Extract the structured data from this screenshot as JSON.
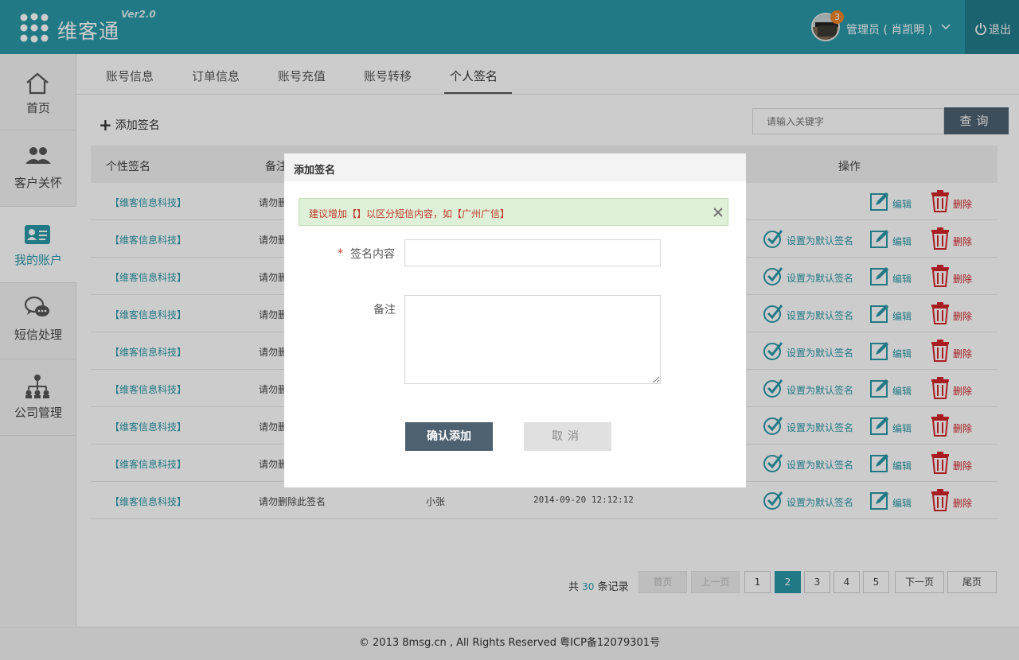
{
  "app": {
    "name": "维客通",
    "version": "Ver2.0"
  },
  "user": {
    "name": "管理员 ( 肖凯明 )",
    "notification_count": "3",
    "logout_label": "退出"
  },
  "sidebar": {
    "items": [
      {
        "label": "首页",
        "icon": "home-icon"
      },
      {
        "label": "客户关怀",
        "icon": "users-icon"
      },
      {
        "label": "我的账户",
        "icon": "id-card-icon",
        "active": true
      },
      {
        "label": "短信处理",
        "icon": "chat-icon"
      },
      {
        "label": "公司管理",
        "icon": "org-chart-icon"
      }
    ]
  },
  "tabs": [
    {
      "label": "账号信息"
    },
    {
      "label": "订单信息"
    },
    {
      "label": "账号充值"
    },
    {
      "label": "账号转移"
    },
    {
      "label": "个人签名",
      "active": true
    }
  ],
  "toolbar": {
    "add_label": "添加签名",
    "search_placeholder": "请输入关键字",
    "search_label": "查询"
  },
  "table": {
    "headers": {
      "signature": "个性签名",
      "remark": "备注",
      "actions": "操作"
    },
    "rows": [
      {
        "signature": "【维客信息科技】",
        "remark": "请勿删",
        "creator": "",
        "time": "",
        "default": true
      },
      {
        "signature": "【维客信息科技】",
        "remark": "请勿删",
        "creator": "",
        "time": "",
        "default": false
      },
      {
        "signature": "【维客信息科技】",
        "remark": "请勿删",
        "creator": "",
        "time": "",
        "default": false
      },
      {
        "signature": "【维客信息科技】",
        "remark": "请勿删",
        "creator": "",
        "time": "",
        "default": false
      },
      {
        "signature": "【维客信息科技】",
        "remark": "请勿删",
        "creator": "",
        "time": "",
        "default": false
      },
      {
        "signature": "【维客信息科技】",
        "remark": "请勿删",
        "creator": "",
        "time": "",
        "default": false
      },
      {
        "signature": "【维客信息科技】",
        "remark": "请勿删",
        "creator": "",
        "time": "",
        "default": false
      },
      {
        "signature": "【维客信息科技】",
        "remark": "请勿删",
        "creator": "",
        "time": "",
        "default": false
      },
      {
        "signature": "【维客信息科技】",
        "remark": "请勿删除此签名",
        "creator": "小张",
        "time": "2014-09-20 12:12:12",
        "default": false
      }
    ],
    "actions": {
      "set_default": "设置为默认签名",
      "edit": "编辑",
      "delete": "删除"
    }
  },
  "pagination": {
    "total_prefix": "共",
    "total": "30",
    "total_suffix": "条记录",
    "first": "首页",
    "prev": "上一页",
    "pages": [
      "1",
      "2",
      "3",
      "4",
      "5"
    ],
    "current": "2",
    "next": "下一页",
    "last": "尾页"
  },
  "footer": {
    "text": "© 2013 8msg.cn , All Rights Reserved 粤ICP备12079301号"
  },
  "modal": {
    "title": "添加签名",
    "hint": "建议增加【】以区分短信内容，如【广州广信】",
    "signature_label": "签名内容",
    "signature_value": "",
    "remark_label": "备注",
    "remark_value": "",
    "confirm_label": "确认添加",
    "cancel_label": "取消"
  },
  "colors": {
    "primary": "#2a98a8",
    "dark_button": "#4d6170",
    "danger": "#d2252a"
  }
}
